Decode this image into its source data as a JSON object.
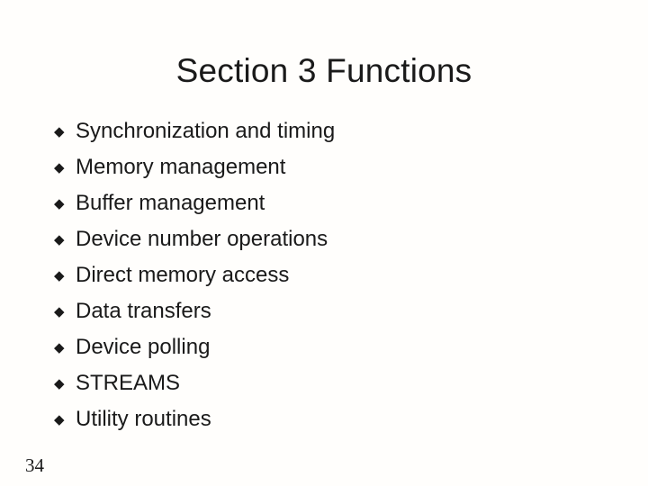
{
  "slide": {
    "title": "Section 3 Functions",
    "bullet_glyph": "◆",
    "bullet_icon_name": "diamond-bullet-icon",
    "page_number": "34",
    "background_color": "#fffefc",
    "text_color": "#1a1a1a",
    "bullets": [
      {
        "label": "Synchronization and timing"
      },
      {
        "label": "Memory management"
      },
      {
        "label": "Buffer management"
      },
      {
        "label": "Device number operations"
      },
      {
        "label": "Direct memory access"
      },
      {
        "label": "Data transfers"
      },
      {
        "label": "Device polling"
      },
      {
        "label": "STREAMS"
      },
      {
        "label": "Utility routines"
      }
    ]
  }
}
